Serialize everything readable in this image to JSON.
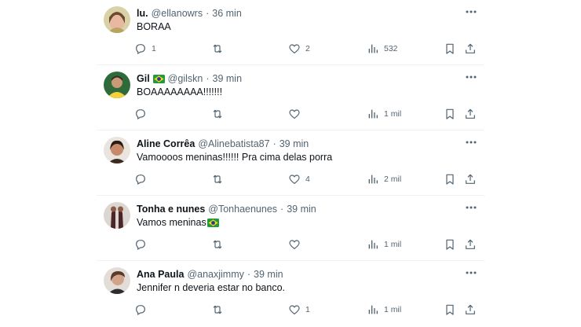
{
  "tweets": [
    {
      "name": "lu.",
      "handle": "@ellanowrs",
      "sep": "·",
      "time": "36 min",
      "text": "BORAA",
      "flag": "",
      "reply_count": "1",
      "retweet_count": "",
      "like_count": "2",
      "view_count": "532"
    },
    {
      "name": "Gil",
      "handle": "@gilskn",
      "sep": "·",
      "time": "39 min",
      "text": "BOAAAAAAAA!!!!!!!",
      "flag": "brazil",
      "reply_count": "",
      "retweet_count": "",
      "like_count": "",
      "view_count": "1 mil"
    },
    {
      "name": "Aline Corrêa",
      "handle": "@Alinebatista87",
      "sep": "·",
      "time": "39 min",
      "text": "Vamoooos meninas!!!!!! Pra cima delas porra",
      "flag": "",
      "reply_count": "",
      "retweet_count": "",
      "like_count": "4",
      "view_count": "2 mil"
    },
    {
      "name": "Tonha e nunes",
      "handle": "@Tonhaenunes",
      "sep": "·",
      "time": "39 min",
      "text": "Vamos meninas",
      "flag": "",
      "text_flag": "brazil",
      "reply_count": "",
      "retweet_count": "",
      "like_count": "",
      "view_count": "1 mil"
    },
    {
      "name": "Ana Paula",
      "handle": "@anaxjimmy",
      "sep": "·",
      "time": "39 min",
      "text": "Jennifer n deveria estar no banco.",
      "flag": "",
      "reply_count": "",
      "retweet_count": "",
      "like_count": "1",
      "view_count": "1 mil"
    }
  ],
  "icons": {
    "more": "more-horizontal-icon",
    "reply": "reply-bubble-icon",
    "retweet": "retweet-arrows-icon",
    "like": "heart-icon",
    "views": "views-bar-chart-icon",
    "bookmark": "bookmark-icon",
    "share": "share-upload-icon",
    "flag": "brazil-flag-icon"
  },
  "colors": {
    "text": "#0f1419",
    "secondary": "#536471",
    "divider": "#eff3f4",
    "background": "#ffffff"
  }
}
